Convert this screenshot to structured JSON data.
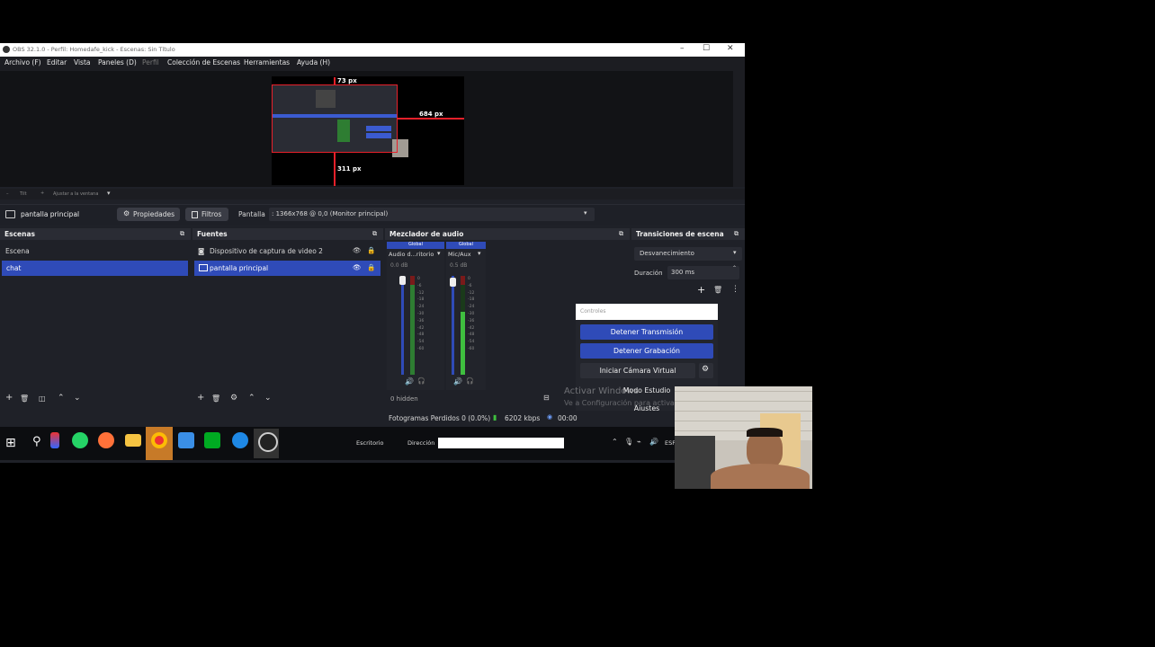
{
  "window": {
    "title": "OBS 32.1.0 - Perfil: Homedafe_kick - Escenas: Sin Título",
    "controls": {
      "minimize": "–",
      "maximize": "☐",
      "close": "✕"
    }
  },
  "menu": [
    "Archivo (F)",
    "Editar",
    "Vista",
    "Paneles (D)",
    "Perfil",
    "Colección de Escenas",
    "Herramientas",
    "Ayuda (H)"
  ],
  "preview": {
    "labels": {
      "top": "73 px",
      "right": "684 px",
      "bottom": "311 px"
    }
  },
  "zoombar": {
    "left": "Tilt",
    "right": "Ajustar a la ventana"
  },
  "source_bar": {
    "selected_source": "pantalla principal",
    "properties_label": "Propiedades",
    "filters_label": "Filtros",
    "display_label": "Pantalla",
    "display_value": ": 1366x768 @ 0,0 (Monitor principal)"
  },
  "scenes": {
    "title": "Escenas",
    "items": [
      {
        "label": "Escena",
        "selected": false
      },
      {
        "label": "chat",
        "selected": true
      }
    ]
  },
  "sources": {
    "title": "Fuentes",
    "items": [
      {
        "label": "Dispositivo de captura de video 2",
        "selected": false
      },
      {
        "label": "pantalla principal",
        "selected": true
      }
    ]
  },
  "mixer": {
    "title": "Mezclador de audio",
    "channels": [
      {
        "tag": "Global",
        "name": "Audio d...ritorio",
        "db": "0.0 dB"
      },
      {
        "tag": "Global",
        "name": "Mic/Aux",
        "db": "0.5 dB"
      }
    ],
    "scale": [
      "0",
      "-6",
      "-12",
      "-18",
      "-24",
      "-30",
      "-36",
      "-42",
      "-48",
      "-54",
      "-60"
    ],
    "hidden_label": "0 hidden"
  },
  "transitions": {
    "title": "Transiciones de escena",
    "type": "Desvanecimiento",
    "duration_label": "Duración",
    "duration_value": "300 ms"
  },
  "controls": {
    "title": "Controles",
    "stop_stream": "Detener Transmisión",
    "stop_record": "Detener Grabación",
    "virtual_cam": "Iniciar Cámara Virtual",
    "studio_mode": "Modo Estudio",
    "settings": "Ajustes",
    "watermark_1": "Activar Windows",
    "watermark_2": "Ve a Configuración para activar"
  },
  "status": {
    "dropped": "Fotogramas Perdidos 0 (0.0%)",
    "bitrate": "6202 kbps",
    "time": "00:00"
  },
  "taskbar": {
    "desktop_label": "Escritorio",
    "address_label": "Dirección",
    "lang": "ESP"
  },
  "colors": {
    "accent": "#2f4bb8",
    "guide_red": "#e8202a",
    "meter_green": "#3fbf3f",
    "panel_bg": "#1f2128"
  }
}
